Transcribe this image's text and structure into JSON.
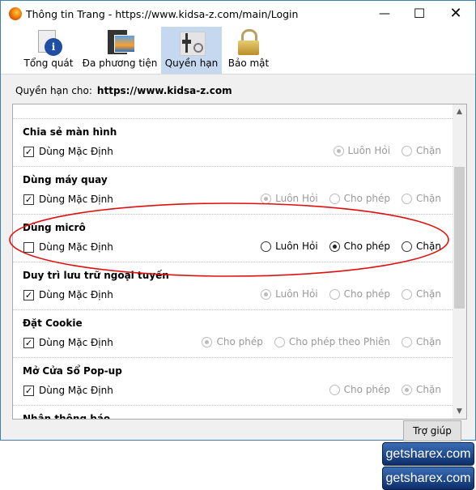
{
  "window": {
    "title": "Thông tin Trang - https://www.kidsa-z.com/main/Login"
  },
  "tabs": [
    {
      "label": "Tổng quát",
      "icon": "info-icon"
    },
    {
      "label": "Đa phương tiện",
      "icon": "media-icon"
    },
    {
      "label": "Quyền hạn",
      "icon": "permissions-icon",
      "selected": true
    },
    {
      "label": "Bảo mật",
      "icon": "lock-icon"
    }
  ],
  "permissions_for": {
    "label": "Quyền hạn cho:",
    "site": "https://www.kidsa-z.com"
  },
  "default_label": "Dùng Mặc Định",
  "sections": [
    {
      "title": "Chia sẻ màn hình",
      "default_checked": true,
      "options": [
        "Luôn Hỏi",
        "Chặn"
      ],
      "selected": "Luôn Hỏi"
    },
    {
      "title": "Dùng máy quay",
      "default_checked": true,
      "options": [
        "Luôn Hỏi",
        "Cho phép",
        "Chặn"
      ],
      "selected": "Luôn Hỏi"
    },
    {
      "title": "Dùng micrô",
      "default_checked": false,
      "options": [
        "Luôn Hỏi",
        "Cho phép",
        "Chặn"
      ],
      "selected": "Cho phép"
    },
    {
      "title": "Duy trì lưu trữ ngoại tuyến",
      "default_checked": true,
      "options": [
        "Luôn Hỏi",
        "Cho phép",
        "Chặn"
      ],
      "selected": "Luôn Hỏi"
    },
    {
      "title": "Đặt Cookie",
      "default_checked": true,
      "options": [
        "Cho phép",
        "Cho phép theo Phiên",
        "Chặn"
      ],
      "selected": "Cho phép"
    },
    {
      "title": "Mở Cửa Sổ Pop-up",
      "default_checked": true,
      "options": [
        "Cho phép",
        "Chặn"
      ],
      "selected": "Chặn"
    },
    {
      "title": "Nhận thông báo"
    }
  ],
  "help_button": "Trợ giúp",
  "watermarks": [
    "getsharex.com",
    "getsharex.com"
  ],
  "colors": {
    "annotation": "#e01010",
    "selected_tab": "#c5d8ef"
  }
}
